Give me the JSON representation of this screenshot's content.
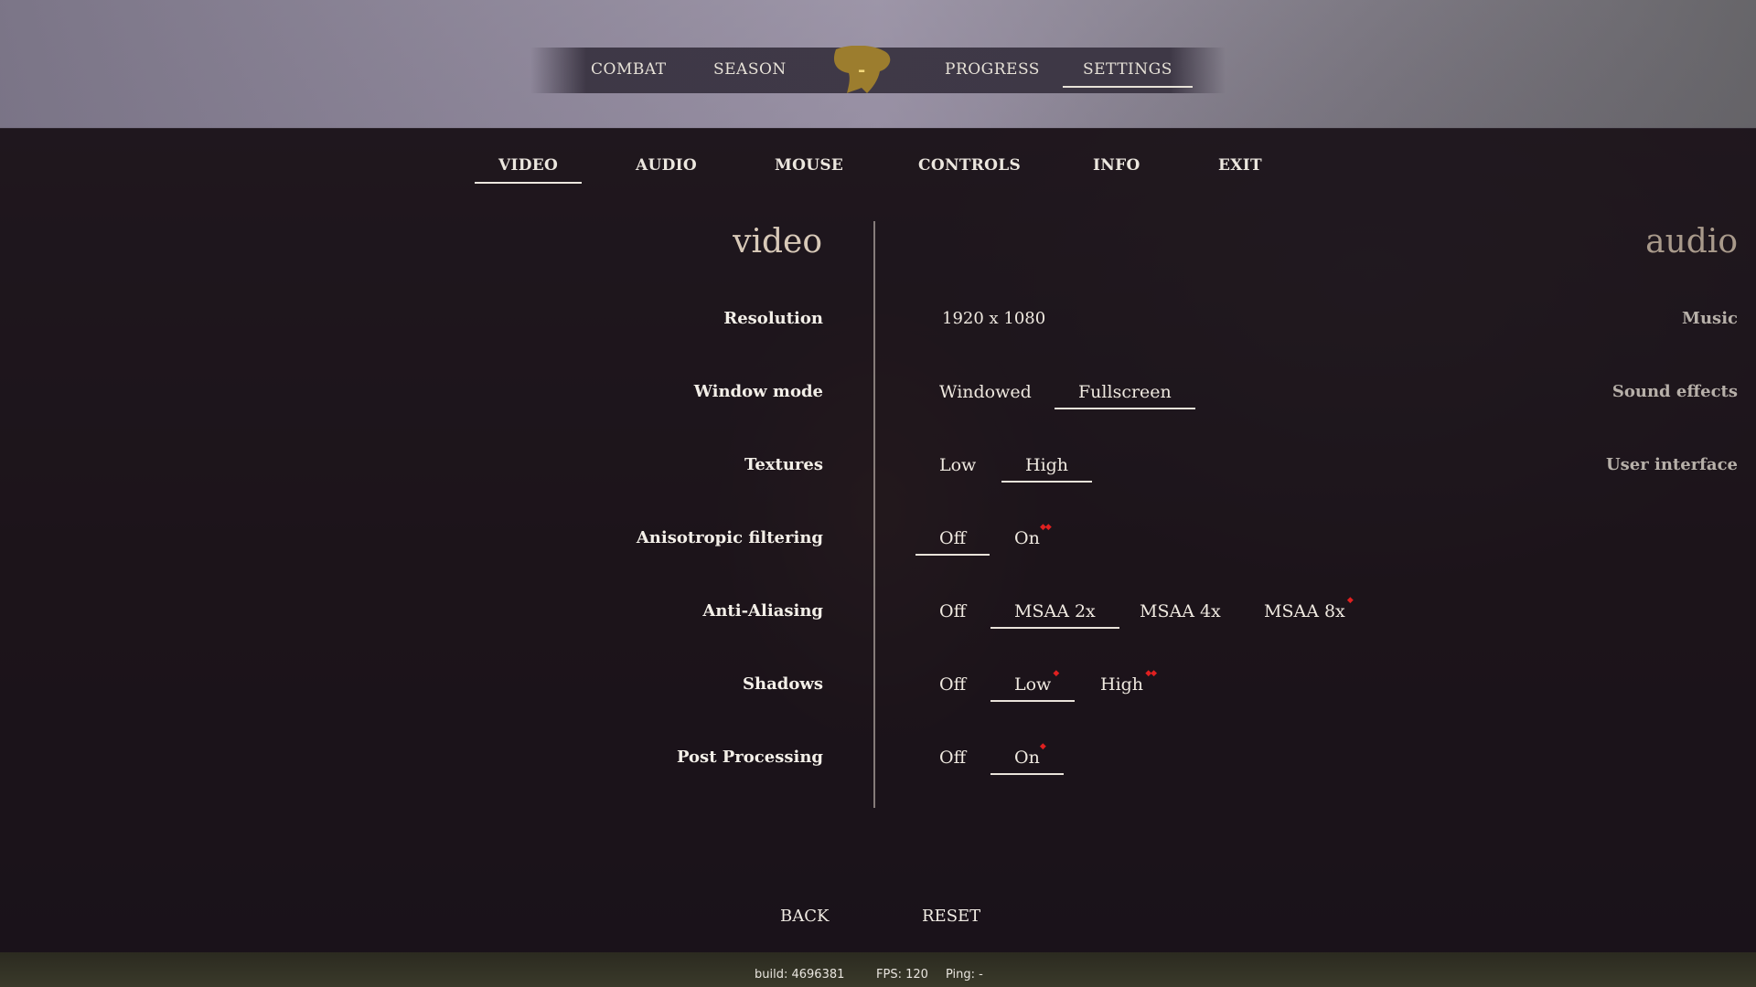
{
  "top_nav": {
    "items": [
      "COMBAT",
      "SEASON",
      "PROGRESS",
      "SETTINGS"
    ],
    "logo_text": "-",
    "active": "SETTINGS"
  },
  "sub_tabs": {
    "items": [
      "VIDEO",
      "AUDIO",
      "MOUSE",
      "CONTROLS",
      "INFO",
      "EXIT"
    ],
    "active": "VIDEO"
  },
  "video": {
    "title": "video",
    "settings": [
      {
        "label": "Resolution",
        "value": "1920 x 1080"
      },
      {
        "label": "Window mode",
        "options": [
          "Windowed",
          "Fullscreen"
        ],
        "selected": "Fullscreen"
      },
      {
        "label": "Textures",
        "options": [
          "Low",
          "High"
        ],
        "selected": "High"
      },
      {
        "label": "Anisotropic filtering",
        "options": [
          "Off",
          "On"
        ],
        "selected": "Off"
      },
      {
        "label": "Anti-Aliasing",
        "options": [
          "Off",
          "MSAA 2x",
          "MSAA 4x",
          "MSAA 8x"
        ],
        "selected": "MSAA 2x"
      },
      {
        "label": "Shadows",
        "options": [
          "Off",
          "Low",
          "High"
        ],
        "selected": "Low"
      },
      {
        "label": "Post Processing",
        "options": [
          "Off",
          "On"
        ],
        "selected": "On"
      }
    ]
  },
  "audio": {
    "title": "audio",
    "settings": [
      "Music",
      "Sound effects",
      "User interface"
    ]
  },
  "buttons": {
    "back": "BACK",
    "reset": "RESET"
  },
  "status": {
    "build": "build: 4696381",
    "fps": "FPS: 120",
    "ping": "Ping: -"
  },
  "colors": {
    "logo_gold": "#9c7d2e",
    "performance_marker": "#e02020"
  }
}
